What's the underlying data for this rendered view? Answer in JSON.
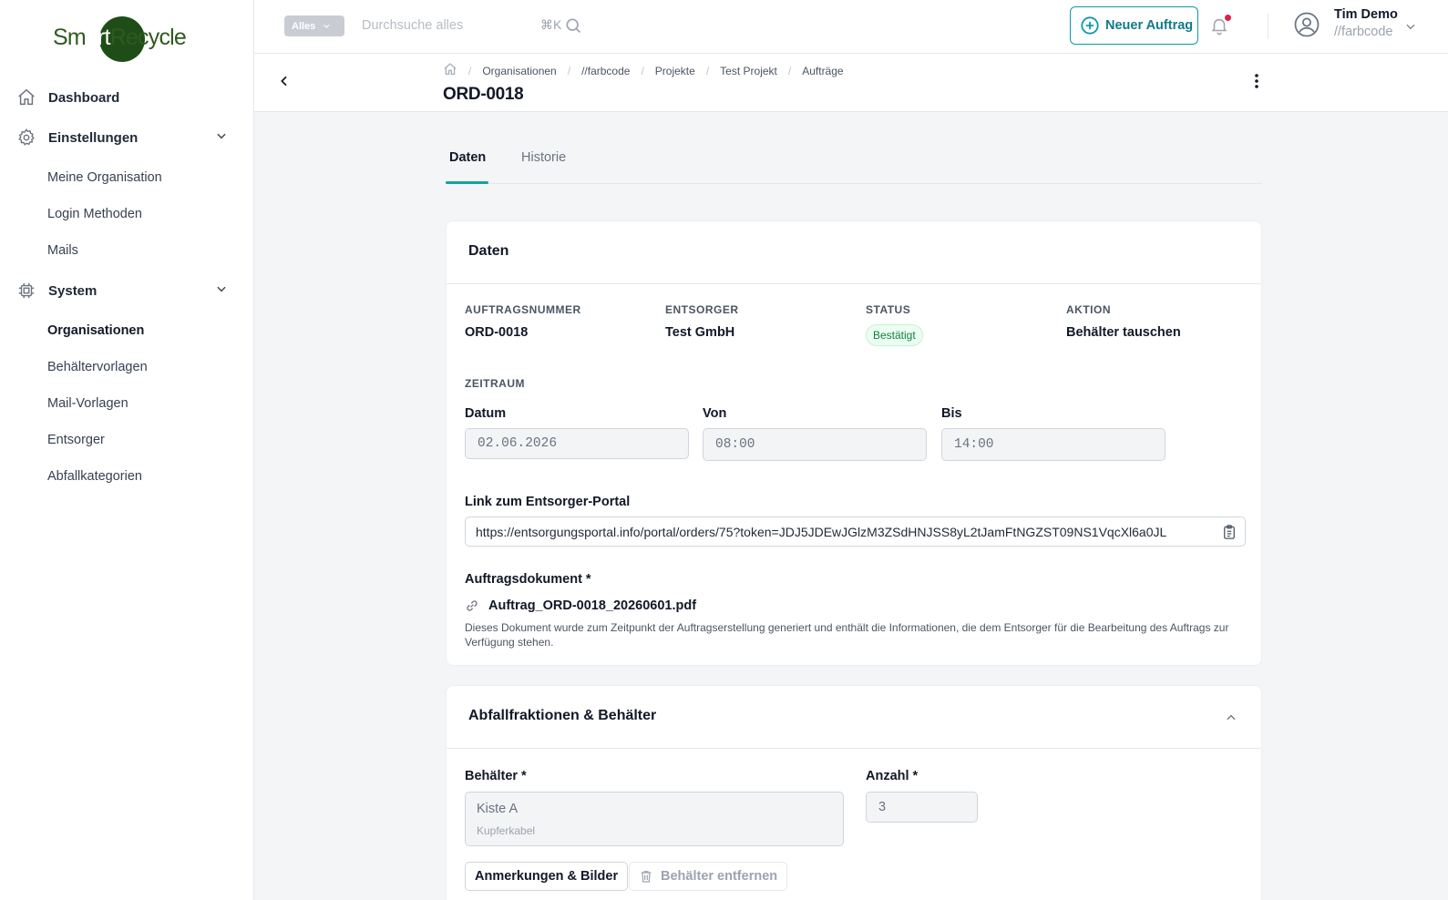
{
  "brand": {
    "logo_left": "Sm",
    "logo_mid": "art",
    "logo_right": "Recycle",
    "color": "#2f5a1f"
  },
  "sidebar": {
    "items": [
      {
        "label": "Dashboard",
        "icon": "home-icon"
      },
      {
        "label": "Einstellungen",
        "icon": "gear-icon"
      },
      {
        "label": "System",
        "icon": "chip-icon"
      }
    ],
    "settings_sub": [
      "Meine Organisation",
      "Login Methoden",
      "Mails"
    ],
    "system_sub": [
      "Organisationen",
      "Behältervorlagen",
      "Mail-Vorlagen",
      "Entsorger",
      "Abfallkategorien"
    ],
    "active_sub": "Organisationen"
  },
  "topbar": {
    "scope": "Alles",
    "search_placeholder": "Durchsuche alles",
    "shortcut": "⌘K",
    "new_order_label": "Neuer Auftrag",
    "user_name": "Tim Demo",
    "user_org": "//farbcode",
    "accent": "#0f9aa8"
  },
  "breadcrumb": [
    "Organisationen",
    "//farbcode",
    "Projekte",
    "Test Projekt",
    "Aufträge"
  ],
  "page_title": "ORD-0018",
  "tabs": [
    {
      "label": "Daten"
    },
    {
      "label": "Historie"
    }
  ],
  "data_card": {
    "title": "Daten",
    "order_number_label": "AUFTRAGSNUMMER",
    "order_number": "ORD-0018",
    "disposer_label": "ENTSORGER",
    "disposer": "Test GmbH",
    "status_label": "STATUS",
    "status": "Bestätigt",
    "action_label": "AKTION",
    "action": "Behälter tauschen",
    "period_label": "ZEITRAUM",
    "date_label": "Datum",
    "date": "02.06.2026",
    "from_label": "Von",
    "from": "08:00",
    "to_label": "Bis",
    "to": "14:00",
    "portal_label": "Link zum Entsorger-Portal",
    "portal_link": "https://entsorgungsportal.info/portal/orders/75?token=JDJ5JDEwJGlzM3ZSdHNJSS8yL2tJamFtNGZST09NS1VqcXl6a0JL",
    "doc_label": "Auftragsdokument *",
    "doc_name": "Auftrag_ORD-0018_20260601.pdf",
    "doc_desc": "Dieses Dokument wurde zum Zeitpunkt der Auftragserstellung generiert und enthält die Informationen, die dem Entsorger für die Bearbeitung des Auftrags zur Verfügung stehen."
  },
  "waste_card": {
    "title": "Abfallfraktionen & Behälter",
    "container_label": "Behälter *",
    "container": "Kiste A",
    "container_sub": "Kupferkabel",
    "count_label": "Anzahl *",
    "count": "3",
    "notes_button": "Anmerkungen & Bilder",
    "remove_button": "Behälter entfernen"
  }
}
